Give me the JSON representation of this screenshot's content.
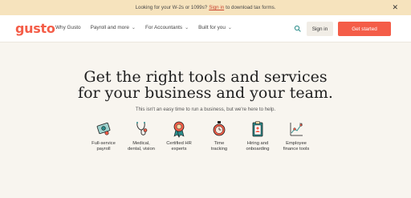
{
  "banner": {
    "text_before": "Looking for your W-2s or 1099s?",
    "link": "Sign in",
    "text_after": "to download tax forms.",
    "close_icon": "close-icon"
  },
  "nav": {
    "logo": "gusto",
    "menu": [
      {
        "label": "Why Gusto",
        "chevron": false
      },
      {
        "label": "Payroll and more",
        "chevron": true
      },
      {
        "label": "For Accountants",
        "chevron": true
      },
      {
        "label": "Built for you",
        "chevron": true
      }
    ],
    "search_icon": "search-icon",
    "signin": "Sign in",
    "get_started": "Get started"
  },
  "hero": {
    "headline_line1": "Get the right tools and services",
    "headline_line2": "for your business and your team.",
    "subheading": "This isn't an easy time to run a business, but we're here to help."
  },
  "features": [
    {
      "line1": "Full-service",
      "line2": "payroll",
      "icon": "money-icon"
    },
    {
      "line1": "Medical,",
      "line2": "dental, vision",
      "icon": "stethoscope-icon"
    },
    {
      "line1": "Certified HR",
      "line2": "experts",
      "icon": "badge-icon"
    },
    {
      "line1": "Time",
      "line2": "tracking",
      "icon": "stopwatch-icon"
    },
    {
      "line1": "Hiring and",
      "line2": "onboarding",
      "icon": "clipboard-icon"
    },
    {
      "line1": "Employee",
      "line2": "finance tools",
      "icon": "chart-icon"
    }
  ],
  "colors": {
    "brand": "#f45d48",
    "banner_bg": "#f6e3bd",
    "page_bg": "#f8f5ef",
    "icon_teal": "#2a8c8a"
  }
}
